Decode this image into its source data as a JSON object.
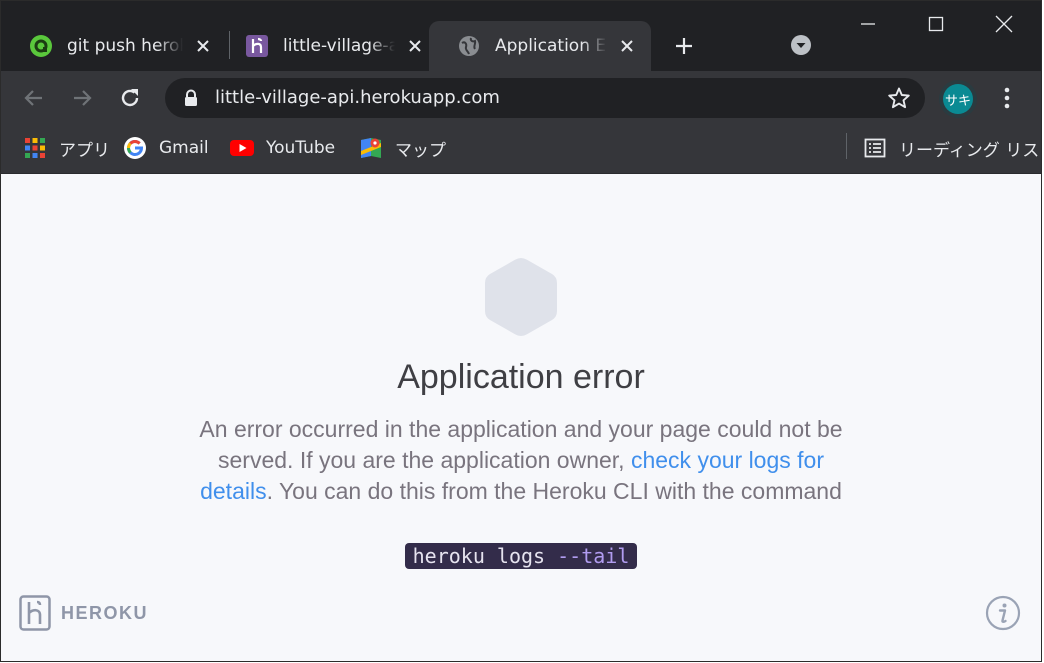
{
  "browser": {
    "tabs": [
      {
        "title": "git push heroku",
        "favicon": "green-circle-icon",
        "active": false
      },
      {
        "title": "little-village-api",
        "favicon": "heroku-icon",
        "active": false
      },
      {
        "title": "Application Error",
        "favicon": "globe-icon",
        "active": true
      }
    ],
    "address_bar": {
      "url": "little-village-api.herokuapp.com"
    },
    "profile": {
      "initials": "サキ"
    },
    "bookmarks": [
      {
        "label": "アプリ",
        "icon": "apps-grid-icon"
      },
      {
        "label": "Gmail",
        "icon": "google-icon"
      },
      {
        "label": "YouTube",
        "icon": "youtube-icon"
      },
      {
        "label": "マップ",
        "icon": "maps-icon"
      }
    ],
    "reading_list": {
      "label": "リーディング リスト"
    }
  },
  "page": {
    "title": "Application error",
    "message_before_link": "An error occurred in the application and your page could not be served. If you are the application owner, ",
    "link_text": "check your logs for details",
    "message_after_link": ". You can do this from the Heroku CLI with the command",
    "command_base": "heroku logs ",
    "command_flag": "--tail",
    "brand": "HEROKU"
  },
  "colors": {
    "link": "#408fec",
    "command_bg": "#332c4a",
    "flag": "#b19cf0",
    "page_bg": "#f7f8fb"
  }
}
